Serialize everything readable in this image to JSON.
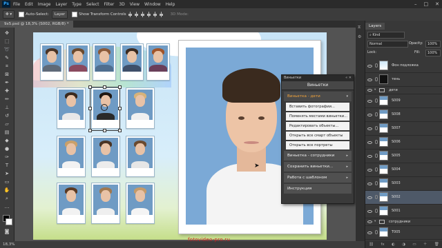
{
  "menubar": {
    "logo": "Ps",
    "items": [
      "File",
      "Edit",
      "Image",
      "Layer",
      "Type",
      "Select",
      "Filter",
      "3D",
      "View",
      "Window",
      "Help"
    ]
  },
  "options_bar": {
    "auto_select_label": "Auto-Select:",
    "auto_select_value": "Layer",
    "show_transform_label": "Show Transform Controls",
    "mode_label": "3D Mode:"
  },
  "document_tab": "9x5.psd @ 18,3% (S002, RGB/8) *",
  "status": {
    "zoom": "18,3%"
  },
  "watermark": "fotovideo-pro.ru",
  "canvas": {
    "staff_photos": [
      {
        "name": "",
        "hair": "#4a3426",
        "shirt": "#5f6a78"
      },
      {
        "name": "",
        "hair": "#6b4a2e",
        "shirt": "#8a4a5f"
      },
      {
        "name": "",
        "hair": "#8a5a3a",
        "shirt": "#4f6e8f"
      },
      {
        "name": "",
        "hair": "#3a2a20",
        "shirt": "#3e4f6a"
      },
      {
        "name": "",
        "hair": "#a0542a",
        "shirt": "#6a3f5a"
      }
    ],
    "kid_photos": [
      {
        "name": "",
        "hair": "#3a2a1e",
        "shirt": "#e8e8e8"
      },
      {
        "name": "",
        "hair": "#201812",
        "shirt": "#2a2a2a"
      },
      {
        "name": "",
        "hair": "#d6b27a",
        "shirt": "#f0f0f0"
      },
      {
        "name": "",
        "hair": "#c9a06a",
        "shirt": "#f2f2f2"
      },
      {
        "name": "",
        "hair": "#4a3424",
        "shirt": "#ececec"
      },
      {
        "name": "",
        "hair": "#6a4a30",
        "shirt": "#e6e6e6"
      },
      {
        "name": "",
        "hair": "#5a3a24",
        "shirt": "#f2f2f2"
      },
      {
        "name": "",
        "hair": "#a07850",
        "shirt": "#efefef"
      },
      {
        "name": "",
        "hair": "#c49a6a",
        "shirt": "#f4f4f4"
      }
    ]
  },
  "plugin": {
    "window_title": "Виньетки",
    "header": "Виньетки",
    "active_section": "Виньетка - дети",
    "sub_items": [
      "Вставить фотографии...",
      "Поменять местами виньетки...",
      "Редактировать объекты...",
      "Открыть все смарт объекты",
      "Открыть все портреты виньеток"
    ],
    "sections": [
      "Виньетка - сотрудники",
      "Сохранить виньетки...",
      "Работа с шаблоном",
      "Инструкция"
    ]
  },
  "layers_panel": {
    "tab": "Layers",
    "filter_label": "Kind",
    "blend_mode": "Normal",
    "opacity_label": "Opacity:",
    "opacity_value": "100%",
    "fill_label": "Fill:",
    "fill_value": "100%",
    "lock_label": "Lock:",
    "layers": [
      {
        "name": "Фон подложка",
        "thumb": "sky",
        "kind": "layer"
      },
      {
        "name": "тень",
        "thumb": "dark",
        "kind": "layer"
      },
      {
        "name": "дети",
        "thumb": "",
        "kind": "group"
      },
      {
        "name": "S009",
        "thumb": "portrait",
        "kind": "layer"
      },
      {
        "name": "S008",
        "thumb": "portrait",
        "kind": "layer"
      },
      {
        "name": "S007",
        "thumb": "portrait",
        "kind": "layer"
      },
      {
        "name": "S006",
        "thumb": "portrait",
        "kind": "layer"
      },
      {
        "name": "S005",
        "thumb": "portrait",
        "kind": "layer"
      },
      {
        "name": "S004",
        "thumb": "portrait",
        "kind": "layer"
      },
      {
        "name": "S003",
        "thumb": "portrait",
        "kind": "layer"
      },
      {
        "name": "S002",
        "thumb": "portrait",
        "kind": "layer",
        "selected": true
      },
      {
        "name": "S001",
        "thumb": "portrait",
        "kind": "layer"
      },
      {
        "name": "сотрудники",
        "thumb": "",
        "kind": "group"
      },
      {
        "name": "T005",
        "thumb": "portrait",
        "kind": "layer"
      }
    ]
  }
}
